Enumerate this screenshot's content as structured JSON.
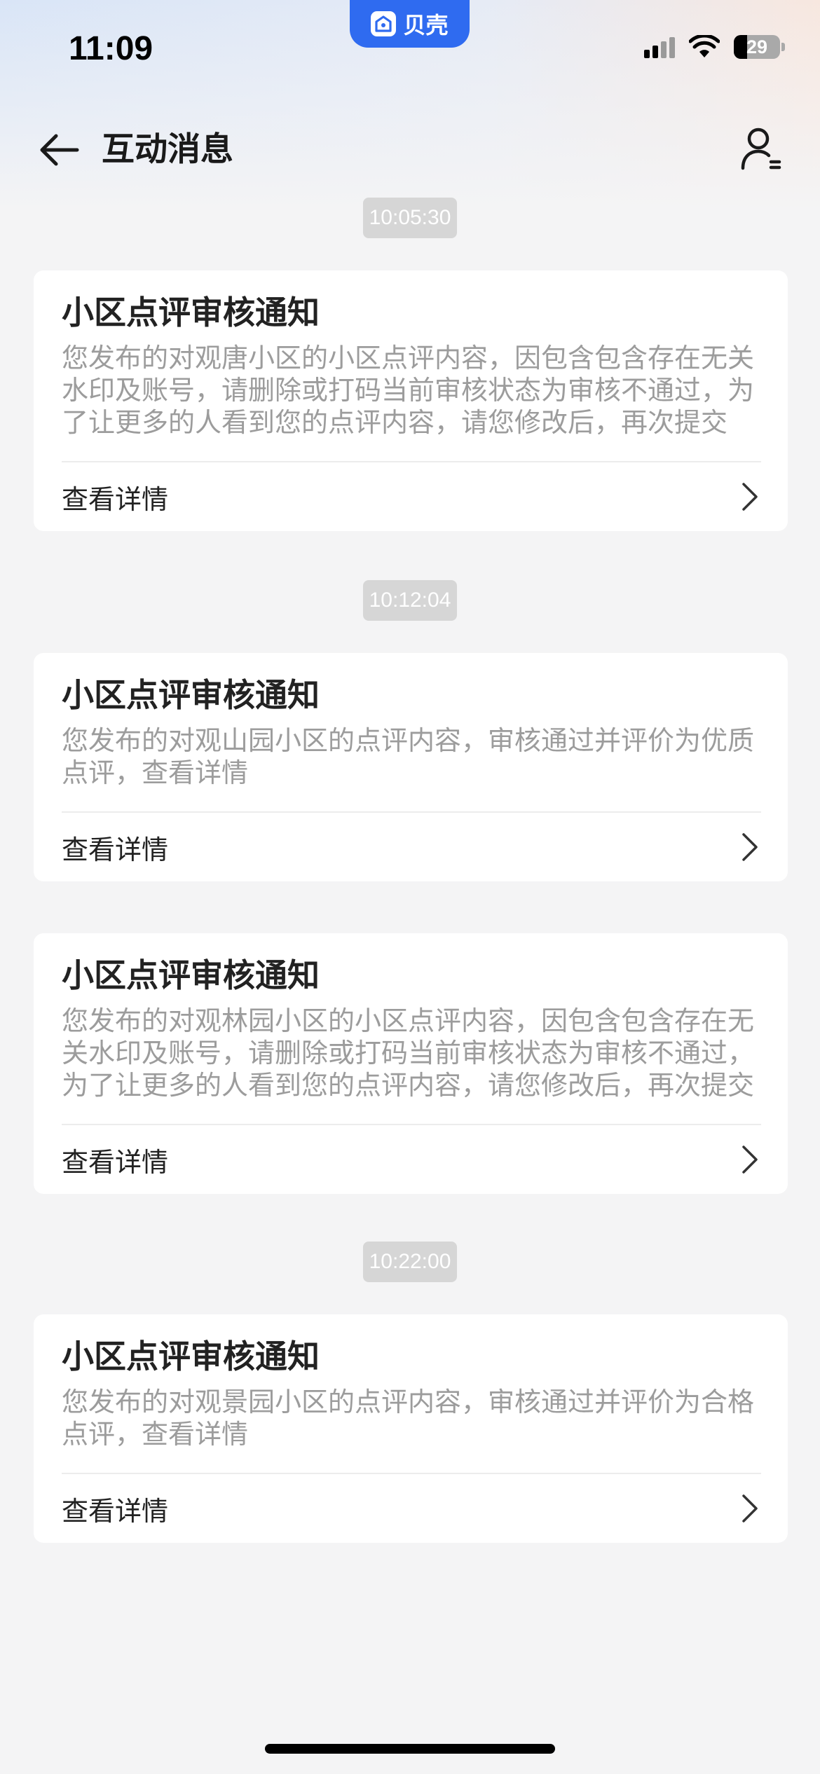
{
  "status_bar": {
    "time": "11:09",
    "app_badge": "贝壳",
    "battery_level": "29",
    "battery_fraction": 0.29
  },
  "nav": {
    "title": "互动消息",
    "back_icon": "arrow-left-icon",
    "right_icon": "user-profile-icon"
  },
  "messages": [
    {
      "time": "10:05:30",
      "title": "小区点评审核通知",
      "body": "您发布的对观唐小区的小区点评内容，因包含包含存在无关水印及账号，请删除或打码当前审核状态为审核不通过，为了让更多的人看到您的点评内容，请您修改后，再次提交",
      "link": "查看详情"
    },
    {
      "time": "10:12:04",
      "title": "小区点评审核通知",
      "body": "您发布的对观山园小区的点评内容，审核通过并评价为优质点评，查看详情",
      "link": "查看详情"
    },
    {
      "time": "",
      "title": "小区点评审核通知",
      "body": "您发布的对观林园小区的小区点评内容，因包含包含存在无关水印及账号，请删除或打码当前审核状态为审核不通过，为了让更多的人看到您的点评内容，请您修改后，再次提交",
      "link": "查看详情"
    },
    {
      "time": "10:22:00",
      "title": "小区点评审核通知",
      "body": "您发布的对观景园小区的点评内容，审核通过并评价为合格点评，查看详情",
      "link": "查看详情"
    }
  ],
  "colors": {
    "accent": "#2f6bf0",
    "background": "#f4f4f5",
    "card": "#ffffff",
    "title_text": "#222222",
    "body_text": "#9c9c9c",
    "time_chip": "#d6d6d6"
  }
}
